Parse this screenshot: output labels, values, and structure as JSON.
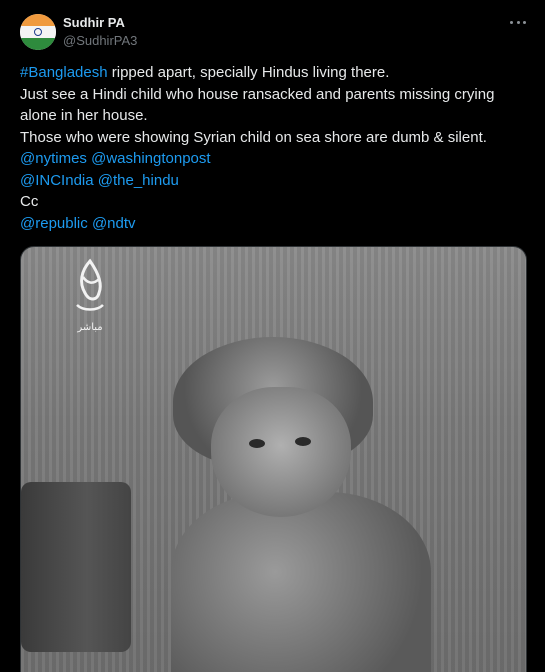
{
  "author": {
    "display_name": "Sudhir PA",
    "handle": "@SudhirPA3",
    "avatar_icon": "india-flag-avatar"
  },
  "more_icon": "more-horizontal-icon",
  "tweet": {
    "hashtag": "#Bangladesh",
    "line1_rest": " ripped apart, specially Hindus living there.",
    "line2": "Just see a Hindi child who house ransacked and parents missing crying",
    "line3": "alone in her house.",
    "line4": "Those who were showing Syrian child on sea shore are dumb & silent.",
    "mention_nytimes": "@nytimes",
    "mention_washingtonpost": "@washingtonpost",
    "mention_incindia": "@INCIndia",
    "mention_thehindu": "@the_hindu",
    "cc": "Cc",
    "mention_republic": "@republic",
    "mention_ndtv": "@ndtv"
  },
  "media": {
    "watermark_text": "مباشر"
  },
  "colors": {
    "background": "#000000",
    "text": "#e7e9ea",
    "secondary": "#71767b",
    "link": "#1d9bf0"
  }
}
